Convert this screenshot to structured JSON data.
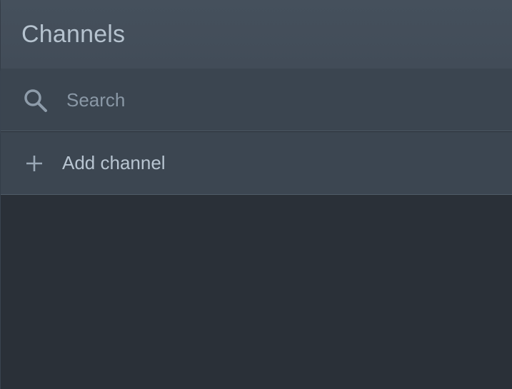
{
  "header": {
    "title": "Channels"
  },
  "search": {
    "placeholder": "Search",
    "value": "",
    "icon": "search-icon"
  },
  "add_channel": {
    "label": "Add channel",
    "icon": "plus-icon"
  },
  "colors": {
    "background": "#2a3038",
    "header": "#45505c",
    "row": "#3b4550",
    "text": "#b6c3cf",
    "placeholder": "#8a98a6"
  }
}
